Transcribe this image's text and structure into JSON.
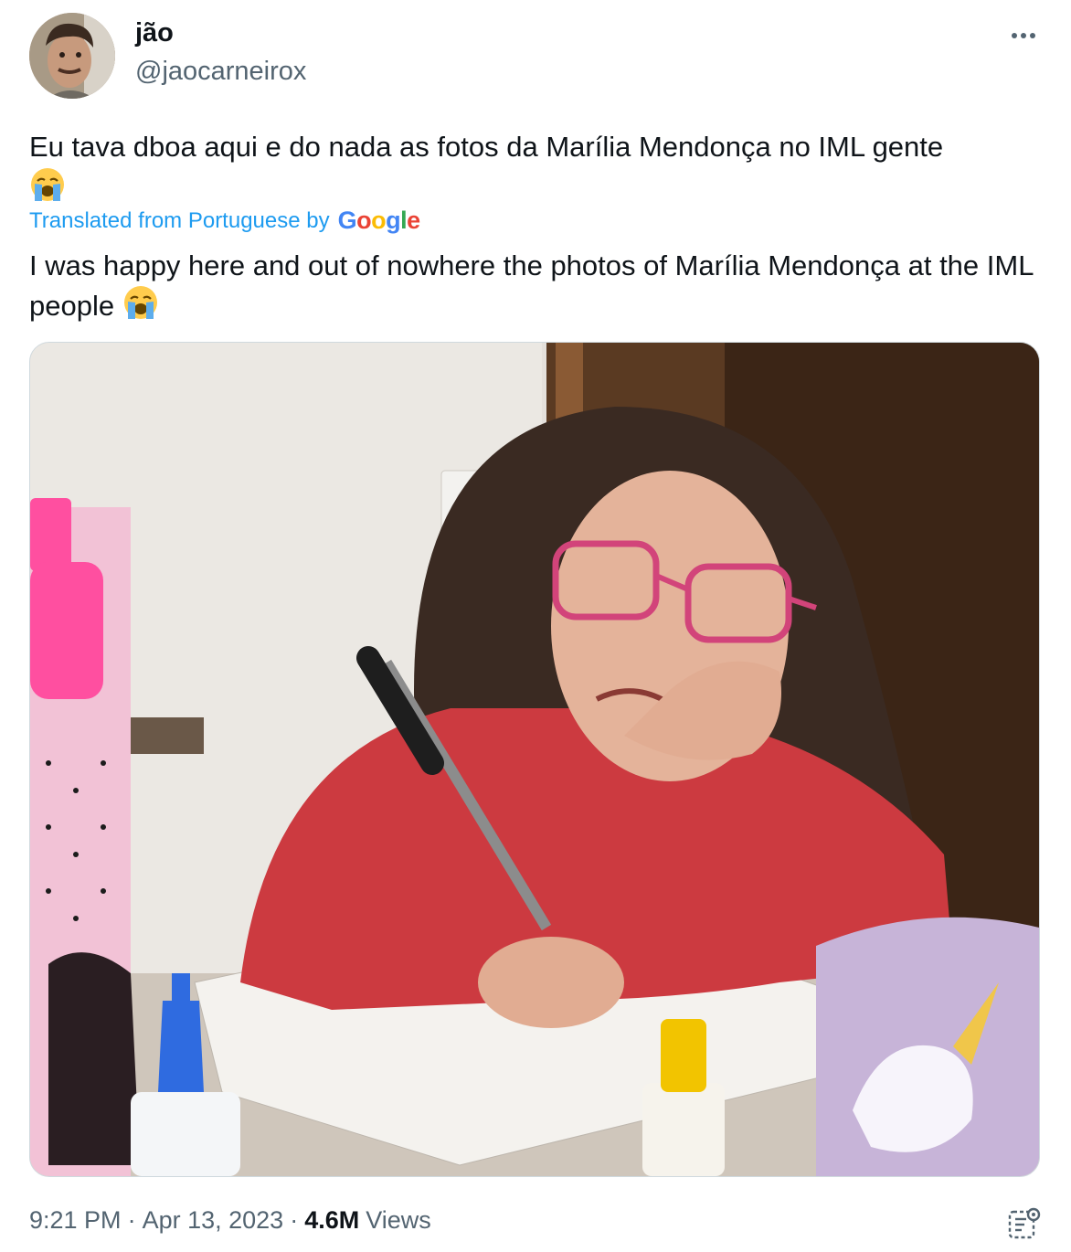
{
  "author": {
    "display_name": "jão",
    "handle": "@jaocarneirox"
  },
  "tweet": {
    "original_text": "Eu tava dboa aqui e do nada as fotos da  Marília Mendonça no IML gente",
    "translated_label": "Translated from Portuguese by",
    "translator_brand": "Google",
    "translation_text": "I was happy here and out of nowhere the photos of Marília Mendonça at the IML people",
    "emoji": "loudly-crying-face"
  },
  "meta": {
    "time": "9:21 PM",
    "separator": "·",
    "date": "Apr 13, 2023",
    "views_count": "4.6M",
    "views_label": "Views"
  },
  "icons": {
    "more": "more-options-icon",
    "analytics": "analytics-icon"
  },
  "colors": {
    "link_blue": "#1d9bf0",
    "text": "#0f1419",
    "secondary": "#536471"
  }
}
